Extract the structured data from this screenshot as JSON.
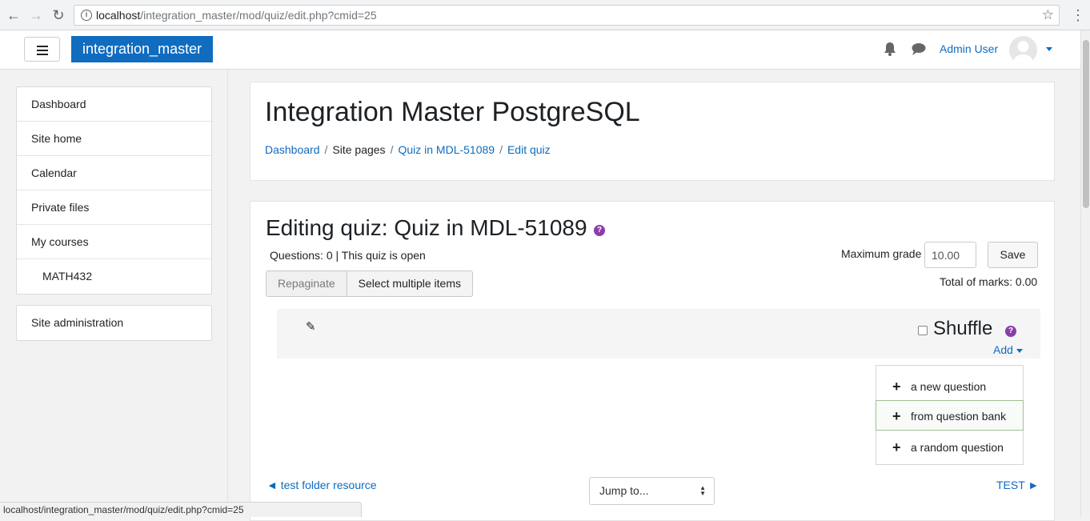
{
  "browser": {
    "url_host": "localhost",
    "url_path": "/integration_master/mod/quiz/edit.php?cmid=25"
  },
  "navbar": {
    "brand": "integration_master",
    "user_name": "Admin User"
  },
  "sidebar": {
    "items": [
      {
        "label": "Dashboard"
      },
      {
        "label": "Site home"
      },
      {
        "label": "Calendar"
      },
      {
        "label": "Private files"
      },
      {
        "label": "My courses"
      },
      {
        "label": "MATH432"
      }
    ],
    "admin": "Site administration"
  },
  "header": {
    "title": "Integration Master PostgreSQL",
    "breadcrumb": [
      "Dashboard",
      "Site pages",
      "Quiz in MDL-51089",
      "Edit quiz"
    ],
    "separator": "/"
  },
  "quiz": {
    "title": "Editing quiz: Quiz in MDL-51089",
    "status": "Questions: 0 | This quiz is open",
    "repaginate": "Repaginate",
    "select_multiple": "Select multiple items",
    "max_grade_label": "Maximum grade",
    "max_grade_value": "10.00",
    "save": "Save",
    "total_marks": "Total of marks: 0.00",
    "shuffle": "Shuffle",
    "add": "Add",
    "add_menu": [
      "a new question",
      "from question bank",
      "a random question"
    ],
    "prev_activity": "◄ test folder resource",
    "next_activity": "TEST ►",
    "jump_to": "Jump to..."
  },
  "status_bar": "localhost/integration_master/mod/quiz/edit.php?cmid=25",
  "colors": {
    "brand": "#0f6cbf",
    "help_icon": "#8b3da8"
  }
}
